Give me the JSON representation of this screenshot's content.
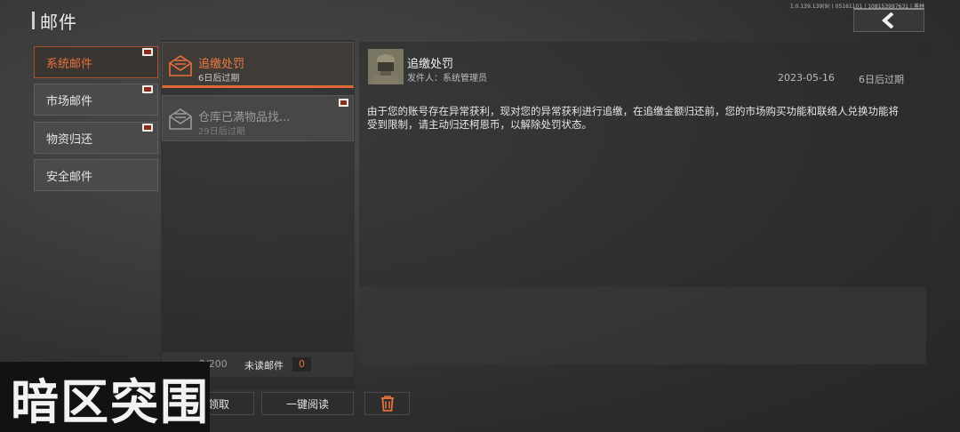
{
  "header": {
    "title": "邮件",
    "version": "1.0.139.139(9)丨05161101丨108153997631丨蒸林"
  },
  "categories": [
    {
      "label": "系统邮件",
      "active": true
    },
    {
      "label": "市场邮件"
    },
    {
      "label": "物资归还"
    },
    {
      "label": "安全邮件"
    }
  ],
  "mails": [
    {
      "title": "追缴处罚",
      "expire": "6日后过期"
    },
    {
      "title": "仓库已满物品找...",
      "expire": "29日后过期"
    }
  ],
  "footer": {
    "count": "2/200",
    "unread_label": "未读邮件",
    "unread_count": "0"
  },
  "detail": {
    "title": "追缴处罚",
    "sender": "发件人：系统管理员",
    "date": "2023-05-16",
    "expire": "6日后过期",
    "body": "由于您的账号存在异常获利，现对您的异常获利进行追缴，在追缴金额归还前，您的市场购买功能和联络人兑换功能将受到限制，请主动归还柯恩币，以解除处罚状态。"
  },
  "actions": {
    "claim_label": "一键领取",
    "read_label": "一键阅读"
  },
  "logo": {
    "text": "暗区突围"
  },
  "colors": {
    "accent": "#e8703c",
    "gift": "#8a2d1e"
  },
  "icons": [
    "back-arrow-icon",
    "gift-icon",
    "envelope-open-icon",
    "trash-icon"
  ]
}
